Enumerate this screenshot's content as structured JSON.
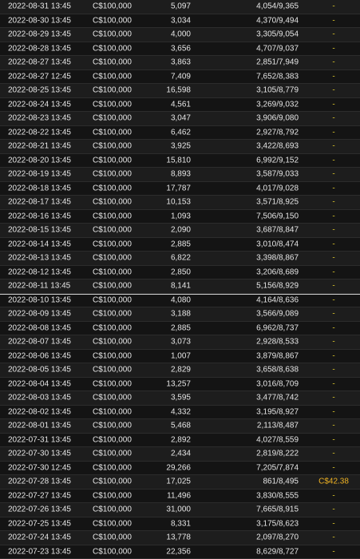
{
  "rows": [
    {
      "date": "2022-08-31 13:45",
      "amount": "C$100,000",
      "entries": "5,097",
      "rank": "4,054/9,365",
      "prize": "-"
    },
    {
      "date": "2022-08-30 13:45",
      "amount": "C$100,000",
      "entries": "3,034",
      "rank": "4,370/9,494",
      "prize": "-"
    },
    {
      "date": "2022-08-29 13:45",
      "amount": "C$100,000",
      "entries": "4,000",
      "rank": "3,305/9,054",
      "prize": "-"
    },
    {
      "date": "2022-08-28 13:45",
      "amount": "C$100,000",
      "entries": "3,656",
      "rank": "4,707/9,037",
      "prize": "-"
    },
    {
      "date": "2022-08-27 13:45",
      "amount": "C$100,000",
      "entries": "3,863",
      "rank": "2,851/7,949",
      "prize": "-"
    },
    {
      "date": "2022-08-27 12:45",
      "amount": "C$100,000",
      "entries": "7,409",
      "rank": "7,652/8,383",
      "prize": "-"
    },
    {
      "date": "2022-08-25 13:45",
      "amount": "C$100,000",
      "entries": "16,598",
      "rank": "3,105/8,779",
      "prize": "-"
    },
    {
      "date": "2022-08-24 13:45",
      "amount": "C$100,000",
      "entries": "4,561",
      "rank": "3,269/9,032",
      "prize": "-"
    },
    {
      "date": "2022-08-23 13:45",
      "amount": "C$100,000",
      "entries": "3,047",
      "rank": "3,906/9,080",
      "prize": "-"
    },
    {
      "date": "2022-08-22 13:45",
      "amount": "C$100,000",
      "entries": "6,462",
      "rank": "2,927/8,792",
      "prize": "-"
    },
    {
      "date": "2022-08-21 13:45",
      "amount": "C$100,000",
      "entries": "3,925",
      "rank": "3,422/8,693",
      "prize": "-"
    },
    {
      "date": "2022-08-20 13:45",
      "amount": "C$100,000",
      "entries": "15,810",
      "rank": "6,992/9,152",
      "prize": "-"
    },
    {
      "date": "2022-08-19 13:45",
      "amount": "C$100,000",
      "entries": "8,893",
      "rank": "3,587/9,033",
      "prize": "-"
    },
    {
      "date": "2022-08-18 13:45",
      "amount": "C$100,000",
      "entries": "17,787",
      "rank": "4,017/9,028",
      "prize": "-"
    },
    {
      "date": "2022-08-17 13:45",
      "amount": "C$100,000",
      "entries": "10,153",
      "rank": "3,571/8,925",
      "prize": "-"
    },
    {
      "date": "2022-08-16 13:45",
      "amount": "C$100,000",
      "entries": "1,093",
      "rank": "7,506/9,150",
      "prize": "-"
    },
    {
      "date": "2022-08-15 13:45",
      "amount": "C$100,000",
      "entries": "2,090",
      "rank": "3,687/8,847",
      "prize": "-"
    },
    {
      "date": "2022-08-14 13:45",
      "amount": "C$100,000",
      "entries": "2,885",
      "rank": "3,010/8,474",
      "prize": "-"
    },
    {
      "date": "2022-08-13 13:45",
      "amount": "C$100,000",
      "entries": "6,822",
      "rank": "3,398/8,867",
      "prize": "-"
    },
    {
      "date": "2022-08-12 13:45",
      "amount": "C$100,000",
      "entries": "2,850",
      "rank": "3,206/8,689",
      "prize": "-"
    },
    {
      "date": "2022-08-11 13:45",
      "amount": "C$100,000",
      "entries": "8,141",
      "rank": "5,156/8,929",
      "prize": "-"
    },
    {
      "date": "2022-08-10 13:45",
      "amount": "C$100,000",
      "entries": "4,080",
      "rank": "4,164/8,636",
      "prize": "-"
    },
    {
      "date": "2022-08-09 13:45",
      "amount": "C$100,000",
      "entries": "3,188",
      "rank": "3,566/9,089",
      "prize": "-"
    },
    {
      "date": "2022-08-08 13:45",
      "amount": "C$100,000",
      "entries": "2,885",
      "rank": "6,962/8,737",
      "prize": "-"
    },
    {
      "date": "2022-08-07 13:45",
      "amount": "C$100,000",
      "entries": "3,073",
      "rank": "2,928/8,533",
      "prize": "-"
    },
    {
      "date": "2022-08-06 13:45",
      "amount": "C$100,000",
      "entries": "1,007",
      "rank": "3,879/8,867",
      "prize": "-"
    },
    {
      "date": "2022-08-05 13:45",
      "amount": "C$100,000",
      "entries": "2,829",
      "rank": "3,658/8,638",
      "prize": "-"
    },
    {
      "date": "2022-08-04 13:45",
      "amount": "C$100,000",
      "entries": "13,257",
      "rank": "3,016/8,709",
      "prize": "-"
    },
    {
      "date": "2022-08-03 13:45",
      "amount": "C$100,000",
      "entries": "3,595",
      "rank": "3,477/8,742",
      "prize": "-"
    },
    {
      "date": "2022-08-02 13:45",
      "amount": "C$100,000",
      "entries": "4,332",
      "rank": "3,195/8,927",
      "prize": "-"
    },
    {
      "date": "2022-08-01 13:45",
      "amount": "C$100,000",
      "entries": "5,468",
      "rank": "2,113/8,487",
      "prize": "-"
    },
    {
      "date": "2022-07-31 13:45",
      "amount": "C$100,000",
      "entries": "2,892",
      "rank": "4,027/8,559",
      "prize": "-"
    },
    {
      "date": "2022-07-30 13:45",
      "amount": "C$100,000",
      "entries": "2,434",
      "rank": "2,819/8,222",
      "prize": "-"
    },
    {
      "date": "2022-07-30 12:45",
      "amount": "C$100,000",
      "entries": "29,266",
      "rank": "7,205/7,874",
      "prize": "-"
    },
    {
      "date": "2022-07-28 13:45",
      "amount": "C$100,000",
      "entries": "17,025",
      "rank": "861/8,495",
      "prize": "C$42.38"
    },
    {
      "date": "2022-07-27 13:45",
      "amount": "C$100,000",
      "entries": "11,496",
      "rank": "3,830/8,555",
      "prize": "-"
    },
    {
      "date": "2022-07-26 13:45",
      "amount": "C$100,000",
      "entries": "31,000",
      "rank": "7,665/8,915",
      "prize": "-"
    },
    {
      "date": "2022-07-25 13:45",
      "amount": "C$100,000",
      "entries": "8,331",
      "rank": "3,175/8,623",
      "prize": "-"
    },
    {
      "date": "2022-07-24 13:45",
      "amount": "C$100,000",
      "entries": "13,778",
      "rank": "2,097/8,270",
      "prize": "-"
    },
    {
      "date": "2022-07-23 13:45",
      "amount": "C$100,000",
      "entries": "22,356",
      "rank": "8,629/8,727",
      "prize": "-"
    }
  ],
  "colors": {
    "row_odd": "#1d1d1d",
    "row_even": "#141414",
    "prize_dash": "#d6c22a",
    "prize_win": "#f0b323"
  }
}
